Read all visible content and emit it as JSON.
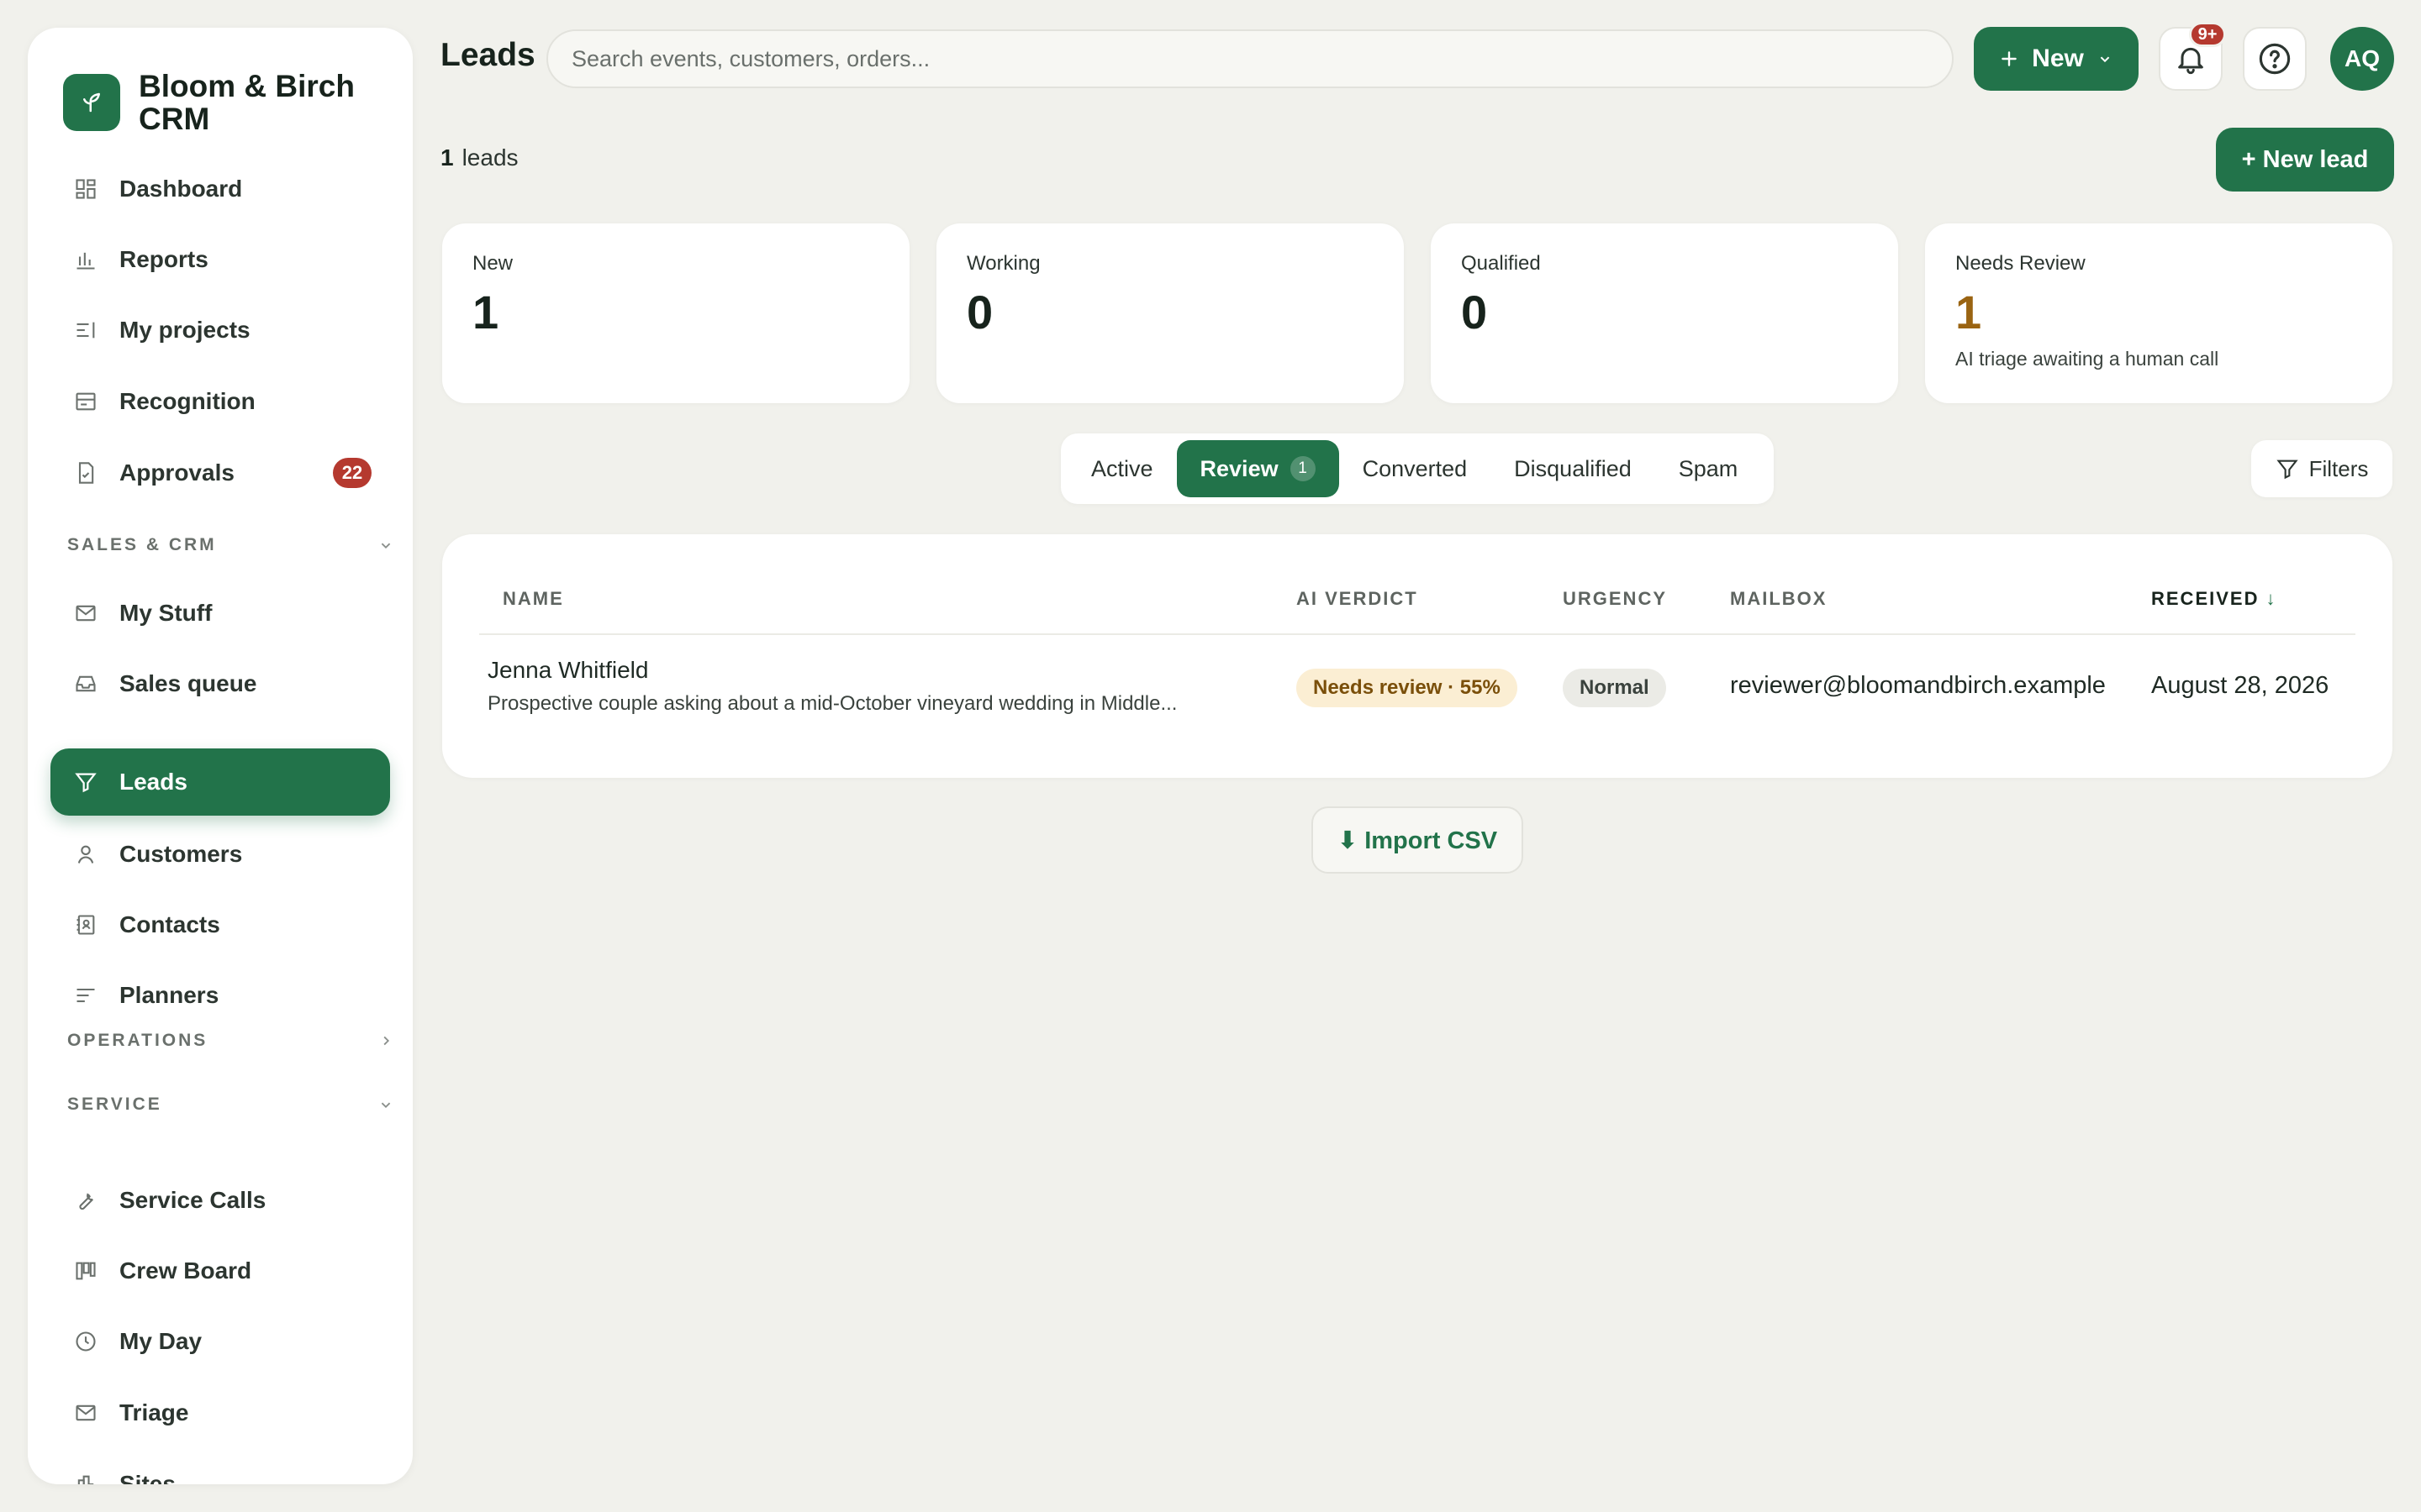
{
  "brand": {
    "name": "Bloom & Birch CRM",
    "logo_icon": "plant-sprout-icon",
    "color": "#22734a"
  },
  "sidebar": {
    "items": [
      {
        "label": "Dashboard",
        "icon": "dashboard-grid-icon"
      },
      {
        "label": "Reports",
        "icon": "bar-chart-icon"
      },
      {
        "label": "My projects",
        "icon": "projects-list-icon"
      },
      {
        "label": "Recognition",
        "icon": "recognition-card-icon"
      },
      {
        "label": "Approvals",
        "icon": "approval-doc-icon",
        "badge": "22"
      }
    ],
    "section_sales": "SALES & CRM",
    "sales_items": [
      {
        "label": "My Stuff",
        "icon": "mail-icon"
      },
      {
        "label": "Sales queue",
        "icon": "inbox-tray-icon"
      },
      {
        "label": "Leads",
        "icon": "funnel-icon",
        "active": true
      },
      {
        "label": "Customers",
        "icon": "person-icon"
      },
      {
        "label": "Contacts",
        "icon": "address-book-icon"
      },
      {
        "label": "Planners",
        "icon": "align-left-icon"
      }
    ],
    "section_operations": "OPERATIONS",
    "section_service": "SERVICE",
    "service_items": [
      {
        "label": "Service Calls",
        "icon": "wrench-icon"
      },
      {
        "label": "Crew Board",
        "icon": "kanban-board-icon"
      },
      {
        "label": "My Day",
        "icon": "clock-icon"
      },
      {
        "label": "Triage",
        "icon": "mail-icon"
      },
      {
        "label": "Sites",
        "icon": "building-chart-icon"
      }
    ]
  },
  "header": {
    "title": "Leads",
    "search_placeholder": "Search events, customers, orders...",
    "new_button": "New",
    "notifications_badge": "9+",
    "avatar_initials": "AQ"
  },
  "summary": {
    "count": "1",
    "count_label": "leads",
    "new_lead_button": "+ New lead"
  },
  "stats": [
    {
      "label": "New",
      "value": "1"
    },
    {
      "label": "Working",
      "value": "0"
    },
    {
      "label": "Qualified",
      "value": "0"
    },
    {
      "label": "Needs Review",
      "value": "1",
      "note": "AI triage awaiting a human call",
      "accent": "#9a6412"
    }
  ],
  "tabs": [
    {
      "label": "Active"
    },
    {
      "label": "Review",
      "count": "1",
      "active": true
    },
    {
      "label": "Converted"
    },
    {
      "label": "Disqualified"
    },
    {
      "label": "Spam"
    }
  ],
  "filters_button": "Filters",
  "table": {
    "columns": {
      "name": "NAME",
      "verdict": "AI VERDICT",
      "urgency": "URGENCY",
      "mailbox": "MAILBOX",
      "received": "RECEIVED"
    },
    "sort_indicator": "↓",
    "rows": [
      {
        "name": "Jenna Whitfield",
        "description": "Prospective couple asking about a mid-October vineyard wedding in Middle...",
        "verdict": "Needs review · 55%",
        "urgency": "Normal",
        "mailbox": "reviewer@bloomandbirch.example",
        "received": "August 28, 2026"
      }
    ]
  },
  "import_button": "⬇ Import CSV"
}
